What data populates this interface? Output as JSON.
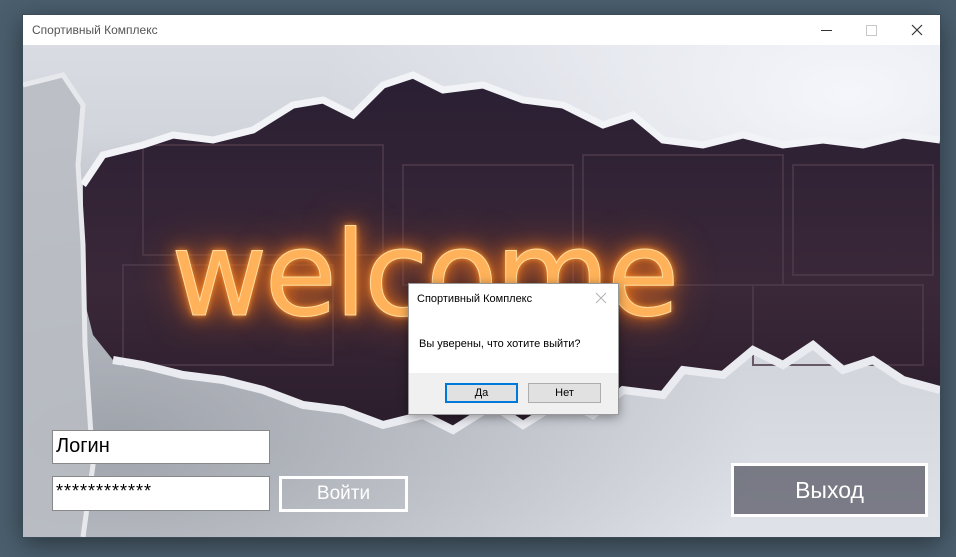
{
  "window": {
    "title": "Спортивный Комплекс"
  },
  "banner": {
    "text": "welcome"
  },
  "form": {
    "login_value": "Логин",
    "password_value": "************",
    "enter_label": "Войти",
    "exit_label": "Выход"
  },
  "dialog": {
    "title": "Спортивный Комплекс",
    "message": "Вы уверены, что хотите выйти?",
    "yes_label": "Да",
    "no_label": "Нет"
  },
  "icons": {
    "minimize": "minimize-icon",
    "maximize": "maximize-icon",
    "close": "close-icon",
    "dialog_close": "close-icon"
  },
  "colors": {
    "desktop": "#4a5e6d",
    "glow": "#ff9a2e",
    "dialog_default_border": "#0078d7"
  }
}
